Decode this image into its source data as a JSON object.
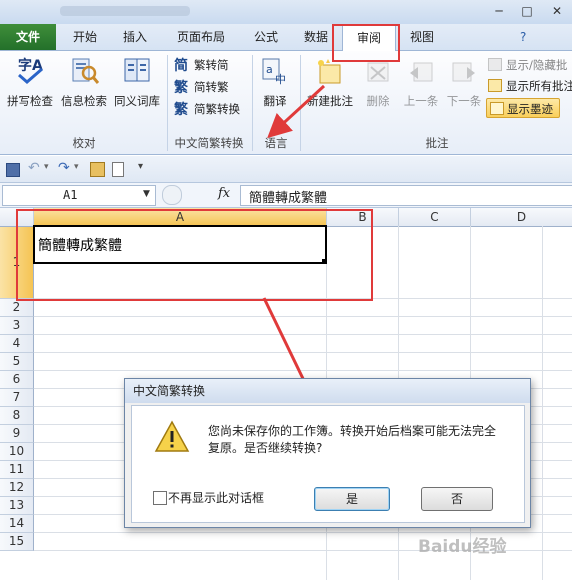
{
  "ribbon_tabs": [
    "文件",
    "开始",
    "插入",
    "页面布局",
    "公式",
    "数据",
    "审阅",
    "视图"
  ],
  "proofing": {
    "spell_check": "拼写检查",
    "info_search": "信息检索",
    "thesaurus": "同义词库",
    "group_label": "校对"
  },
  "chinese_conversion": {
    "to_simplified": "繁转简",
    "to_traditional": "简转繁",
    "convert": "简繁转换",
    "group_label": "中文简繁转换"
  },
  "language": {
    "translate": "翻译",
    "group_label": "语言"
  },
  "comments": {
    "new_comment": "新建批注",
    "delete": "删除",
    "previous": "上一条",
    "next": "下一条",
    "show_hide": "显示/隐藏批",
    "show_all": "显示所有批注",
    "show_ink": "显示墨迹",
    "group_label": "批注"
  },
  "formula_bar": {
    "name_box": "A1",
    "fx": "fx",
    "content": "簡體轉成繁體"
  },
  "columns": [
    "A",
    "B",
    "C",
    "D"
  ],
  "rows": [
    "1",
    "2",
    "3",
    "4",
    "5",
    "6",
    "7",
    "8",
    "9",
    "10",
    "11",
    "12",
    "13",
    "14",
    "15"
  ],
  "cell_a1": "簡體轉成繁體",
  "dialog": {
    "title": "中文简繁转换",
    "message_line1": "您尚未保存你的工作簿。转换开始后档案可能无法完全",
    "message_line2": "复原。是否继续转换?",
    "checkbox_label": "不再显示此对话框",
    "yes": "是",
    "no": "否"
  },
  "watermark": "Baidu经验",
  "colors": {
    "file_tab": "#2f8035",
    "annotation": "#e03a3a",
    "selection": "#f7c84a"
  }
}
